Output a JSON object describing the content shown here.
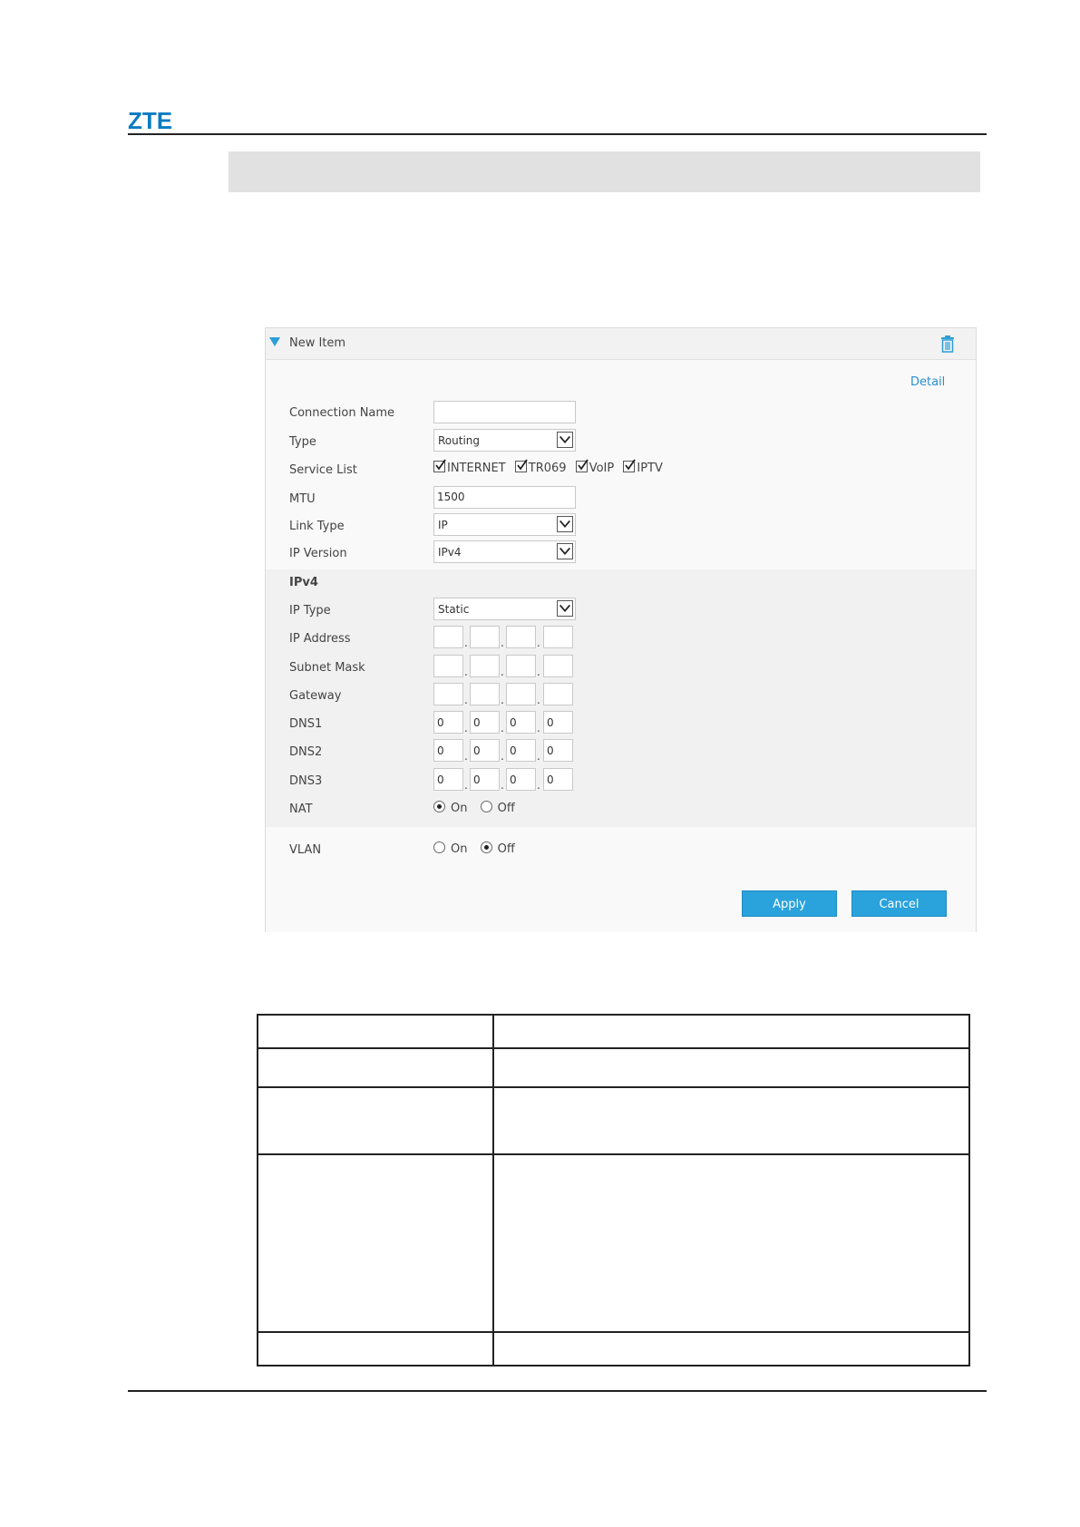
{
  "header": {
    "logo": "ZTE"
  },
  "panel": {
    "title": "New Item",
    "detail_link": "Detail",
    "fields": {
      "connection_name": {
        "label": "Connection Name",
        "value": ""
      },
      "type": {
        "label": "Type",
        "value": "Routing"
      },
      "service_list": {
        "label": "Service List",
        "options": [
          {
            "label": "INTERNET",
            "checked": true
          },
          {
            "label": "TR069",
            "checked": true
          },
          {
            "label": "VoIP",
            "checked": true
          },
          {
            "label": "IPTV",
            "checked": true
          }
        ]
      },
      "mtu": {
        "label": "MTU",
        "value": "1500"
      },
      "link_type": {
        "label": "Link Type",
        "value": "IP"
      },
      "ip_version": {
        "label": "IP Version",
        "value": "IPv4"
      }
    },
    "ipv4": {
      "section_title": "IPv4",
      "ip_type": {
        "label": "IP Type",
        "value": "Static"
      },
      "ip_address": {
        "label": "IP Address",
        "octets": [
          "",
          "",
          "",
          ""
        ]
      },
      "subnet_mask": {
        "label": "Subnet Mask",
        "octets": [
          "",
          "",
          "",
          ""
        ]
      },
      "gateway": {
        "label": "Gateway",
        "octets": [
          "",
          "",
          "",
          ""
        ]
      },
      "dns1": {
        "label": "DNS1",
        "octets": [
          "0",
          "0",
          "0",
          "0"
        ]
      },
      "dns2": {
        "label": "DNS2",
        "octets": [
          "0",
          "0",
          "0",
          "0"
        ]
      },
      "dns3": {
        "label": "DNS3",
        "octets": [
          "0",
          "0",
          "0",
          "0"
        ]
      },
      "nat": {
        "label": "NAT",
        "on_label": "On",
        "off_label": "Off",
        "selected": "On"
      }
    },
    "vlan": {
      "label": "VLAN",
      "on_label": "On",
      "off_label": "Off",
      "selected": "Off"
    },
    "buttons": {
      "apply": "Apply",
      "cancel": "Cancel"
    }
  },
  "icons": {
    "collapse": "triangle-down-icon",
    "delete": "trash-icon",
    "dropdown": "chevron-down-icon",
    "check": "checkmark-icon"
  },
  "colors": {
    "accent": "#2aa2dc",
    "logo": "#0a7cc1",
    "link": "#2a8fd0"
  }
}
